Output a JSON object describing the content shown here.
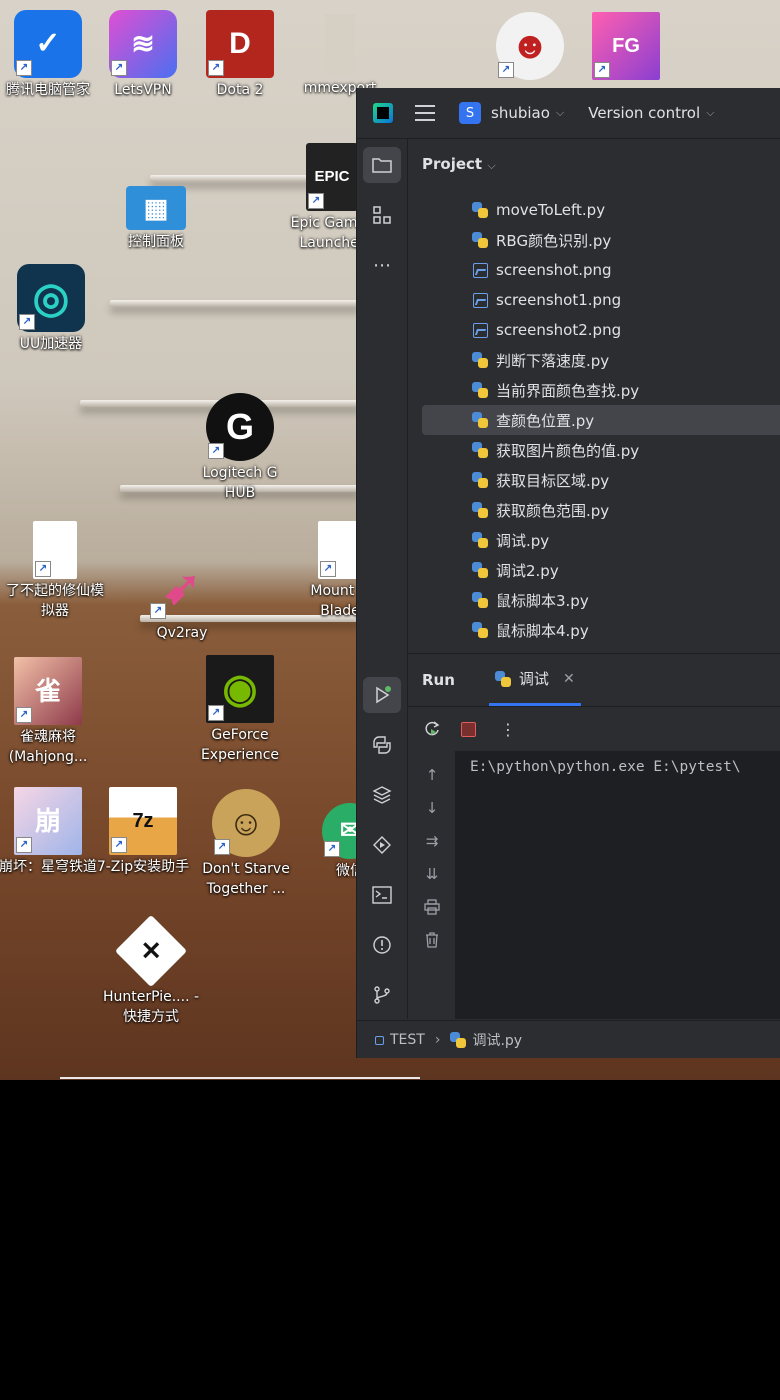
{
  "desktop": {
    "icons": [
      {
        "name": "tencent-pc-manager",
        "label": "腾讯电脑管家",
        "color": "#1a73e8",
        "glyph": "✓"
      },
      {
        "name": "letsvpn",
        "label": "LetsVPN",
        "color": "#7b5cd6",
        "glyph": "≋"
      },
      {
        "name": "dota2",
        "label": "Dota 2",
        "color": "#b3261e",
        "glyph": "D"
      },
      {
        "name": "mmexport",
        "label": "mmexport",
        "color": "#cfc8bc",
        "glyph": ""
      },
      {
        "name": "game-face",
        "label": "",
        "color": "#f2f2f2",
        "glyph": "☻"
      },
      {
        "name": "fall-guys",
        "label": "",
        "color": "#8a3fd1",
        "glyph": "FG"
      },
      {
        "name": "epic-games",
        "label": "Epic Games Launcher",
        "color": "#222",
        "glyph": "EPIC"
      },
      {
        "name": "control-panel",
        "label": "控制面板",
        "color": "#2f8fd8",
        "glyph": "▦"
      },
      {
        "name": "uu-accelerator",
        "label": "UU加速器",
        "color": "#10344d",
        "glyph": "◎"
      },
      {
        "name": "logitech-ghub",
        "label": "Logitech G HUB",
        "color": "#111",
        "glyph": "G"
      },
      {
        "name": "cultivation-sim",
        "label": "了不起的修仙模拟器",
        "color": "#ffffff",
        "glyph": ""
      },
      {
        "name": "qv2ray",
        "label": "Qv2ray",
        "color": "transparent",
        "glyph": "➹"
      },
      {
        "name": "mount-blade",
        "label": "Mount & Blade",
        "color": "#ffffff",
        "glyph": ""
      },
      {
        "name": "mahjong-soul",
        "label": "雀魂麻将(Mahjong...",
        "color": "#c97a8a",
        "glyph": "雀"
      },
      {
        "name": "geforce-experience",
        "label": "GeForce Experience",
        "color": "#1a1a1a",
        "glyph": "◉"
      },
      {
        "name": "honkai-star-rail",
        "label": "崩坏：星穹铁道",
        "color": "#e9b6d0",
        "glyph": "崩"
      },
      {
        "name": "7zip-installer",
        "label": "7-Zip安装助手",
        "color": "#e8a646",
        "glyph": "7z"
      },
      {
        "name": "dont-starve-together",
        "label": "Don't Starve Together ...",
        "color": "#c9a35a",
        "glyph": "☺"
      },
      {
        "name": "wechat",
        "label": "微信",
        "color": "#2aae67",
        "glyph": "✉"
      },
      {
        "name": "hunterpie",
        "label": "HunterPie.... - 快捷方式",
        "color": "#ffffff",
        "glyph": "✕"
      }
    ]
  },
  "ide": {
    "project_badge": "S",
    "project_name": "shubiao",
    "vcs": "Version control",
    "panel_title": "Project",
    "files": [
      {
        "name": "moveToLeft.py",
        "type": "py"
      },
      {
        "name": "RBG颜色识别.py",
        "type": "py"
      },
      {
        "name": "screenshot.png",
        "type": "png"
      },
      {
        "name": "screenshot1.png",
        "type": "png"
      },
      {
        "name": "screenshot2.png",
        "type": "png"
      },
      {
        "name": "判断下落速度.py",
        "type": "py"
      },
      {
        "name": "当前界面颜色查找.py",
        "type": "py"
      },
      {
        "name": "查颜色位置.py",
        "type": "py",
        "selected": true
      },
      {
        "name": "获取图片颜色的值.py",
        "type": "py"
      },
      {
        "name": "获取目标区域.py",
        "type": "py"
      },
      {
        "name": "获取颜色范围.py",
        "type": "py"
      },
      {
        "name": "调试.py",
        "type": "py"
      },
      {
        "name": "调试2.py",
        "type": "py"
      },
      {
        "name": "鼠标脚本3.py",
        "type": "py"
      },
      {
        "name": "鼠标脚本4.py",
        "type": "py"
      }
    ],
    "run": {
      "title": "Run",
      "tab": "调试",
      "console": "E:\\python\\python.exe E:\\pytest\\"
    },
    "status": {
      "project": "TEST",
      "file": "调试.py"
    },
    "accent": "#3574f0"
  }
}
